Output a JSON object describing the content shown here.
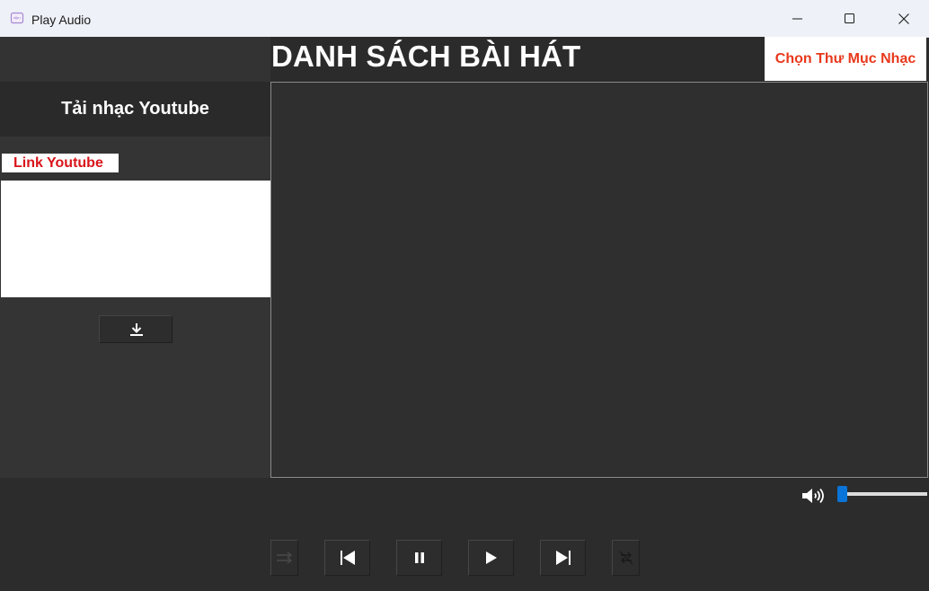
{
  "window": {
    "title": "Play Audio"
  },
  "header": {
    "playlist_title": "DANH SÁCH BÀI HÁT",
    "choose_folder_label": "Chọn Thư Mục Nhạc"
  },
  "youtube": {
    "heading": "Tải nhạc Youtube",
    "link_label": "Link Youtube",
    "link_value": "",
    "download_icon": "download-icon"
  },
  "playlist": {
    "items": []
  },
  "volume": {
    "icon": "volume-icon",
    "level": 0.0
  },
  "controls": {
    "icons": [
      "shuffle-icon",
      "previous-icon",
      "pause-icon",
      "play-icon",
      "next-icon",
      "repeat-icon"
    ]
  },
  "colors": {
    "accent_red": "#d8151b",
    "folder_label": "#e8381c",
    "volume_thumb": "#0a74d8"
  }
}
